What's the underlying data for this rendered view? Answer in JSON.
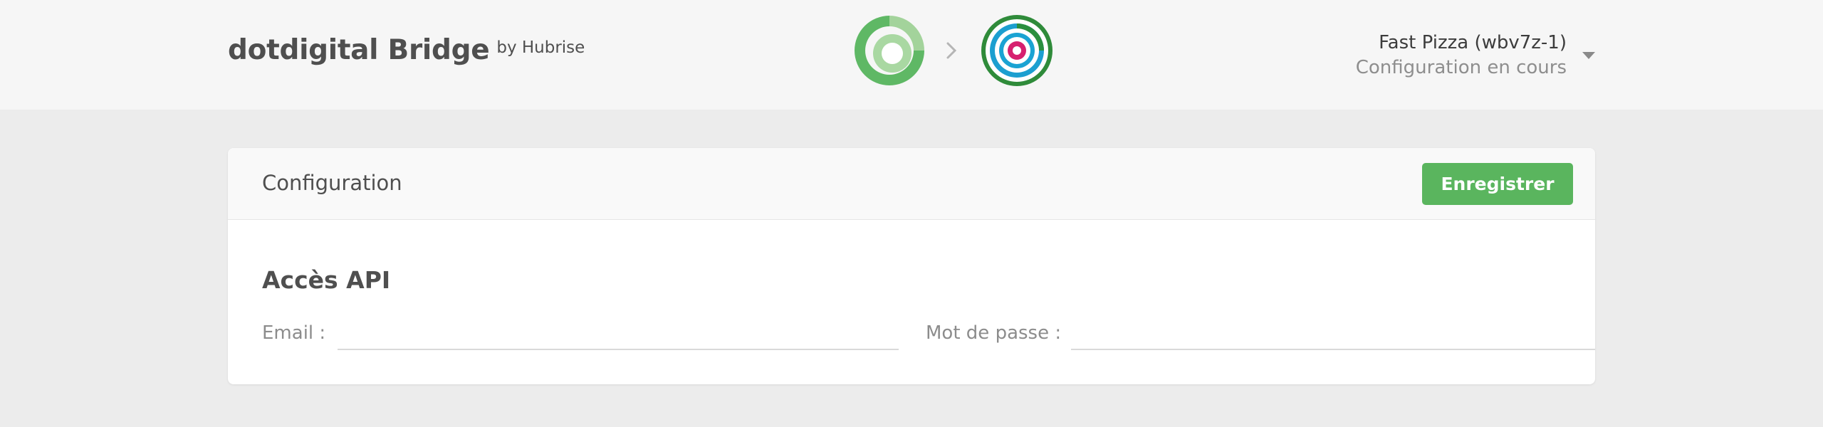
{
  "header": {
    "brand_title": "dotdigital Bridge",
    "brand_by": "by Hubrise",
    "account_name": "Fast Pizza (wbv7z-1)",
    "account_status": "Configuration en cours",
    "icons": [
      "dotdigital-logo-icon",
      "chevron-right-icon",
      "hubrise-logo-icon",
      "caret-down-icon"
    ]
  },
  "config": {
    "title": "Configuration",
    "save_label": "Enregistrer",
    "section_title": "Accès API",
    "email_label": "Email :",
    "email_value": "",
    "password_label": "Mot de passe :",
    "password_value": ""
  },
  "colors": {
    "accent": "#5ab55e",
    "header_bg": "#f6f6f6",
    "page_bg": "#ececec"
  }
}
